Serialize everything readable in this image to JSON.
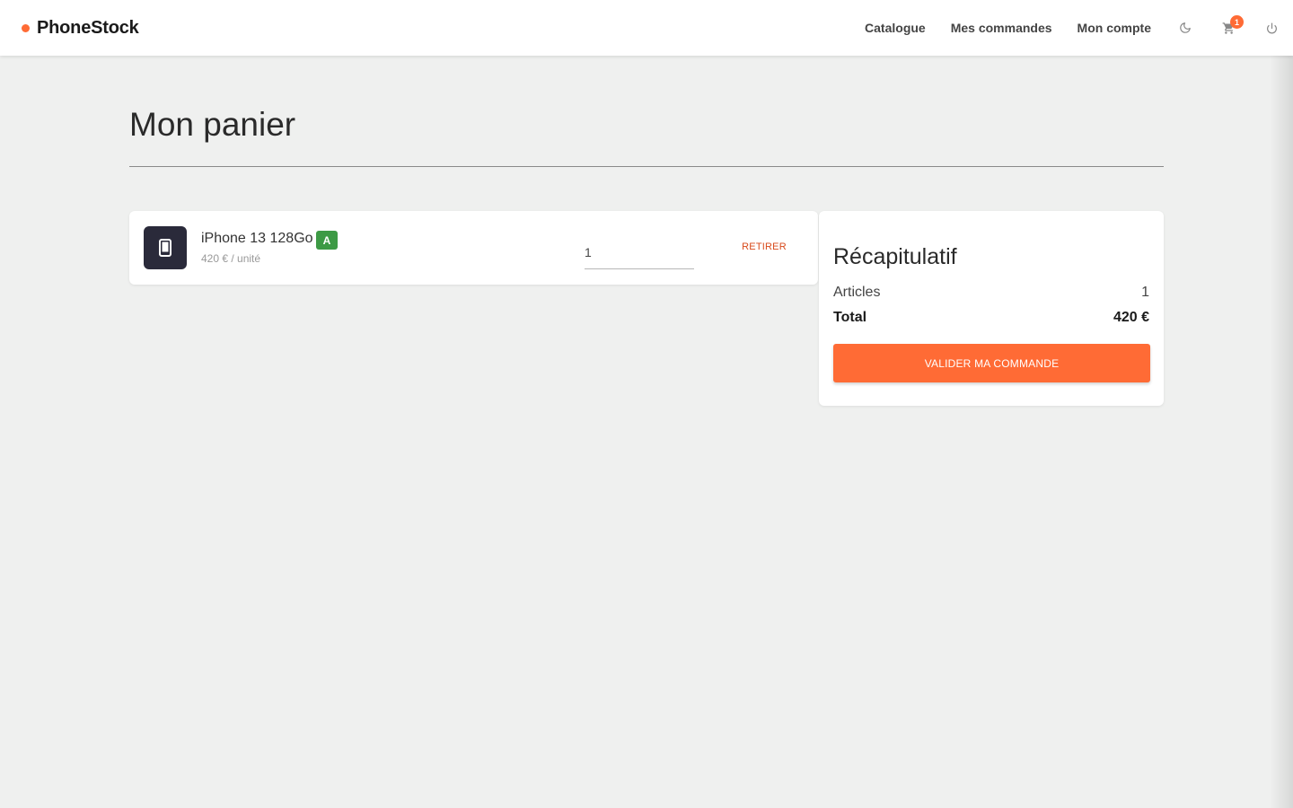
{
  "brand": {
    "name": "PhoneStock",
    "accent_color": "#ff6b35"
  },
  "nav": {
    "links": [
      "Catalogue",
      "Mes commandes",
      "Mon compte"
    ],
    "icons": [
      "moon-icon",
      "cart-icon",
      "power-icon"
    ],
    "cart_count": "1"
  },
  "page": {
    "title": "Mon panier"
  },
  "cart": {
    "items": [
      {
        "name": "iPhone 13 128Go",
        "grade": "A",
        "unit_price": "420 € / unité",
        "quantity": "1",
        "remove_label": "RETIRER",
        "icon": "smartphone-icon"
      }
    ]
  },
  "summary": {
    "title": "Récapitulatif",
    "articles_label": "Articles",
    "articles_value": "1",
    "total_label": "Total",
    "total_value": "420 €",
    "validate_label": "VALIDER MA COMMANDE"
  }
}
